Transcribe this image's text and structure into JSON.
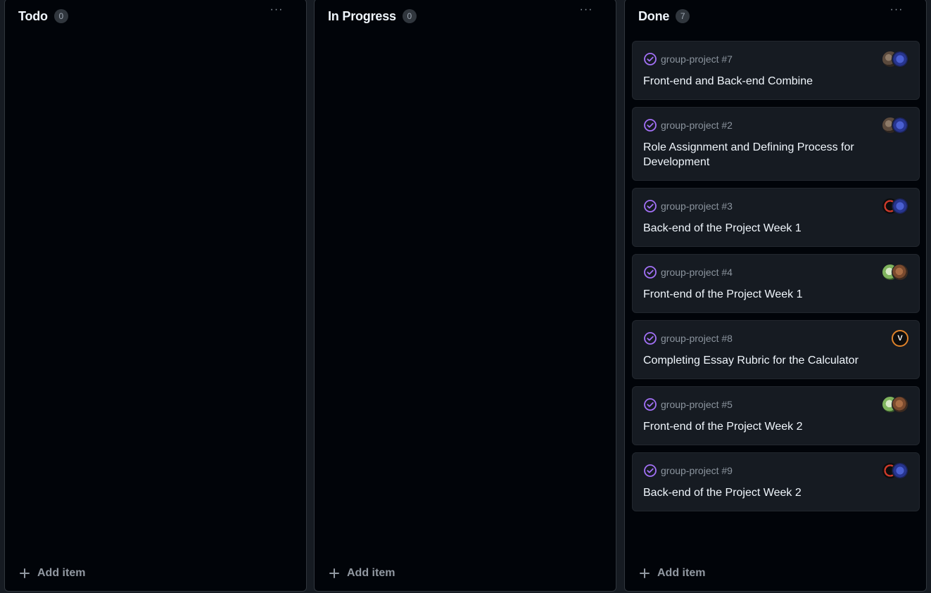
{
  "columns": [
    {
      "id": "todo",
      "title": "Todo",
      "count": "0",
      "add_label": "Add item",
      "more_label": "···"
    },
    {
      "id": "in-progress",
      "title": "In Progress",
      "count": "0",
      "add_label": "Add item",
      "more_label": "···"
    },
    {
      "id": "done",
      "title": "Done",
      "count": "7",
      "add_label": "Add item",
      "more_label": "···"
    }
  ],
  "done_cards": [
    {
      "ref": "group-project #7",
      "title": "Front-end and Back-end Combine",
      "assignees": [
        "blue-avatar",
        "brown-avatar"
      ]
    },
    {
      "ref": "group-project #2",
      "title": "Role Assignment and Defining Process for Development",
      "assignees": [
        "blue-avatar",
        "brown-avatar"
      ]
    },
    {
      "ref": "group-project #3",
      "title": "Back-end of the Project Week 1",
      "assignees": [
        "blue-avatar",
        "red-ring-avatar"
      ]
    },
    {
      "ref": "group-project #4",
      "title": "Front-end of the Project Week 1",
      "assignees": [
        "earth-avatar",
        "green-avatar"
      ]
    },
    {
      "ref": "group-project #8",
      "title": "Completing Essay Rubric for the Calculator",
      "assignees": [
        "v-avatar"
      ],
      "avatar_letter": "V"
    },
    {
      "ref": "group-project #5",
      "title": "Front-end of the Project Week 2",
      "assignees": [
        "earth-avatar",
        "green-avatar"
      ]
    },
    {
      "ref": "group-project #9",
      "title": "Back-end of the Project Week 2",
      "assignees": [
        "blue-avatar",
        "red-ring-avatar"
      ]
    }
  ],
  "colors": {
    "background": "#161b22",
    "column": "#010409",
    "card": "#161b22",
    "done_check": "#a371f7",
    "muted_text": "#8b949e"
  }
}
